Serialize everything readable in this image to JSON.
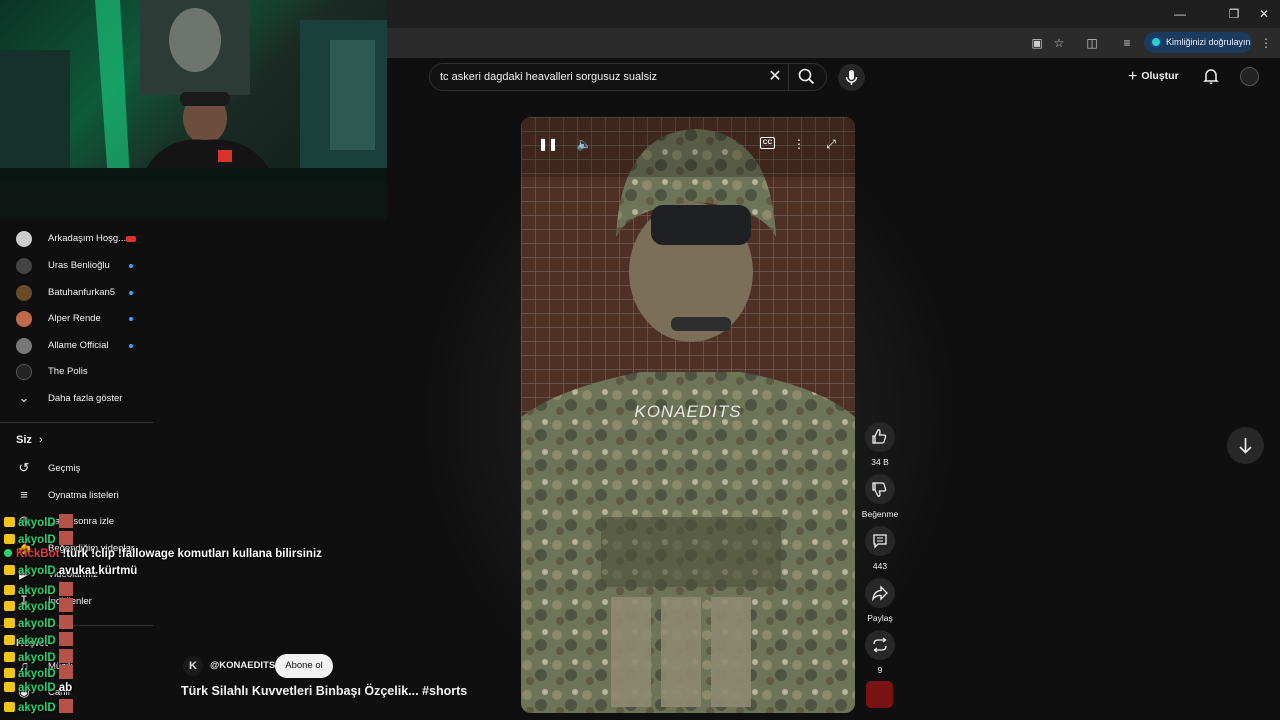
{
  "browser": {
    "verify_label": "Kimliğinizi doğrulayın"
  },
  "header": {
    "search_query": "tc askeri dagdaki heavalleri sorgusuz sualsiz",
    "create_label": "Oluştur"
  },
  "sidebar": {
    "subscriptions": [
      {
        "label": "Arkadaşım Hoşg...",
        "color": "#cccccc",
        "live": true
      },
      {
        "label": "Uras Benlioğlu",
        "color": "#444444",
        "dot": true
      },
      {
        "label": "Batuhanfurkan5",
        "color": "#6b4a2a",
        "dot": true
      },
      {
        "label": "Alper Rende",
        "color": "#c26a4a",
        "dot": true
      },
      {
        "label": "Allame Official",
        "color": "#777777",
        "dot": true
      },
      {
        "label": "The Polis",
        "color": "#222222",
        "dot": false
      }
    ],
    "show_more": "Daha fazla göster",
    "you_label": "Siz",
    "you_items": [
      "Geçmiş",
      "Oynatma listeleri",
      "Daha sonra izle",
      "Beğendiğim videolar",
      "Videolarınız",
      "İndirilenler"
    ],
    "explore_label": "Keşfet",
    "explore_items": [
      "Müzik",
      "Canlı"
    ]
  },
  "chat": [
    {
      "user": "akyolD",
      "msg": ""
    },
    {
      "user": "akyolD",
      "msg": ""
    },
    {
      "user": "KickBot",
      "msg": "!türk !clip !fallowage komutları kullana bilirsiniz",
      "bot": true
    },
    {
      "user": "akyolD",
      "msg": "avukat kürtmü"
    },
    {
      "user": "akyolD",
      "msg": ""
    },
    {
      "user": "akyolD",
      "msg": ""
    },
    {
      "user": "akyolD",
      "msg": ""
    },
    {
      "user": "akyolD",
      "msg": ""
    },
    {
      "user": "akyolD",
      "msg": ""
    },
    {
      "user": "akyolD",
      "msg": ""
    },
    {
      "user": "akyolD",
      "msg": ""
    },
    {
      "user": "akyolD",
      "msg": "ab"
    },
    {
      "user": "akyolD",
      "msg": ""
    },
    {
      "user": "akyolD",
      "msg": ""
    }
  ],
  "short": {
    "watermark": "KONAEDITS",
    "channel_logo": "K",
    "channel": "@KONAEDITS",
    "subscribe_label": "Abone ol",
    "title": "Türk Silahlı Kuvvetleri Binbaşı Özçelik... #shorts",
    "cc_label": "CC"
  },
  "actions": {
    "likes": "34 B",
    "dislike_label": "Beğenme",
    "comments": "443",
    "share_label": "Paylaş",
    "remix_count": "9"
  }
}
